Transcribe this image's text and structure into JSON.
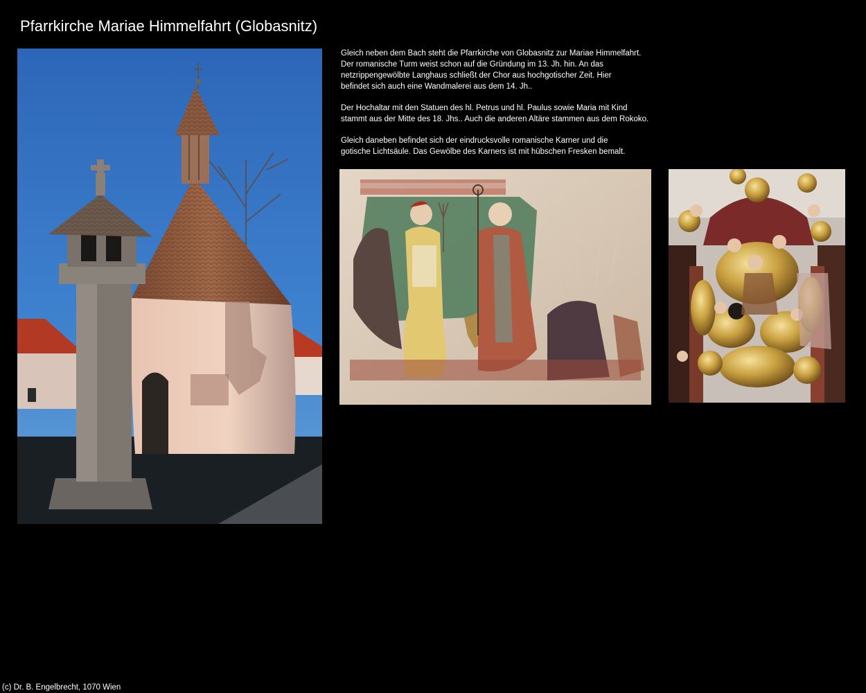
{
  "page": {
    "title": "Pfarrkirche Mariae Himmelfahrt (Globasnitz)",
    "background": "#000000",
    "text_color": "#ffffff"
  },
  "description": {
    "paragraphs": [
      {
        "lines": [
          "Gleich neben dem Bach steht die Pfarrkirche von Globasnitz zur Mariae Himmelfahrt.",
          "Der romanische Turm weist schon auf die Gründung im 13. Jh. hin. An das",
          "netzrippengewölbte Langhaus schließt der Chor aus hochgotischer Zeit. Hier",
          "befindet sich auch eine Wandmalerei aus dem 14. Jh.."
        ]
      },
      {
        "lines": [
          "Der Hochaltar mit den Statuen des hl. Petrus und hl. Paulus sowie Maria mit Kind",
          "stammt aus der Mitte des 18. Jhs.. Auch die anderen Altäre stammen aus dem Rokoko."
        ]
      },
      {
        "lines": [
          "Gleich daneben befindet sich der eindrucksvolle romanische Karner und die",
          "gotische Lichtsäule. Das Gewölbe des Karners ist mit hübschen Fresken bemalt."
        ]
      }
    ]
  },
  "images": {
    "main": "karner-and-lichtsaeule-photo",
    "fresco": "fresco-wall-painting-photo",
    "altar": "baroque-altar-detail-photo"
  },
  "footer": {
    "copyright": "(c) Dr. B. Engelbrecht, 1070 Wien"
  }
}
